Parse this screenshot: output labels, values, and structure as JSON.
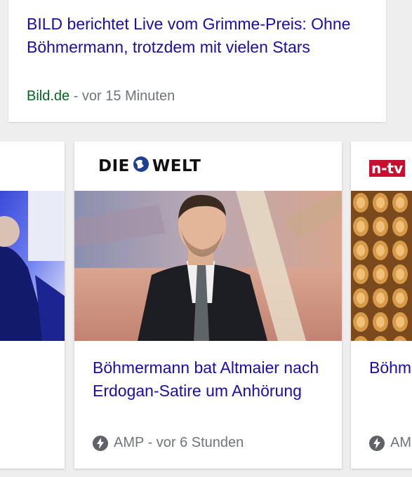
{
  "top_result": {
    "title": "BILD berichtet Live vom Grimme-Preis: Ohne Böhmermann, trotzdem mit vielen Stars",
    "source": "Bild.de",
    "time": " - vor 15 Minuten"
  },
  "carousel": {
    "main": {
      "publisher_logo_text_left": "DIE",
      "publisher_logo_text_right": "WELT",
      "headline": "Böhmermann bat Altmaier nach Erdogan-Satire um Anhörung",
      "meta": "AMP - vor 6 Stunden",
      "icon": "amp-bolt-icon"
    },
    "right": {
      "publisher_logo_text": "n-tv",
      "headline": "Böhm Kanz",
      "meta": "AM",
      "icon": "amp-bolt-icon"
    }
  },
  "colors": {
    "link": "#1a0dab",
    "source_green": "#006621",
    "meta_gray": "#70757a",
    "ntv_red": "#c8102e"
  }
}
